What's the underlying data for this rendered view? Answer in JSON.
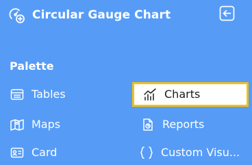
{
  "header": {
    "title": "Circular Gauge Chart",
    "logo_icon": "gauge-add-icon",
    "collapse_icon": "collapse-left-arrow-icon"
  },
  "palette": {
    "heading": "Palette",
    "items": [
      {
        "label": "Tables",
        "icon": "table-icon",
        "selected": false
      },
      {
        "label": "Charts",
        "icon": "line-chart-icon",
        "selected": true
      },
      {
        "label": "Maps",
        "icon": "map-icon",
        "selected": false
      },
      {
        "label": "Reports",
        "icon": "report-icon",
        "selected": false
      },
      {
        "label": "Card",
        "icon": "card-icon",
        "selected": false
      },
      {
        "label": "Custom Visu...",
        "icon": "braces-icon",
        "selected": false
      }
    ]
  },
  "colors": {
    "background": "#569cf7",
    "text": "#ffffff",
    "selected_border": "#f4c012",
    "selected_background": "#ffffff",
    "selected_text": "#1c1c1c"
  }
}
